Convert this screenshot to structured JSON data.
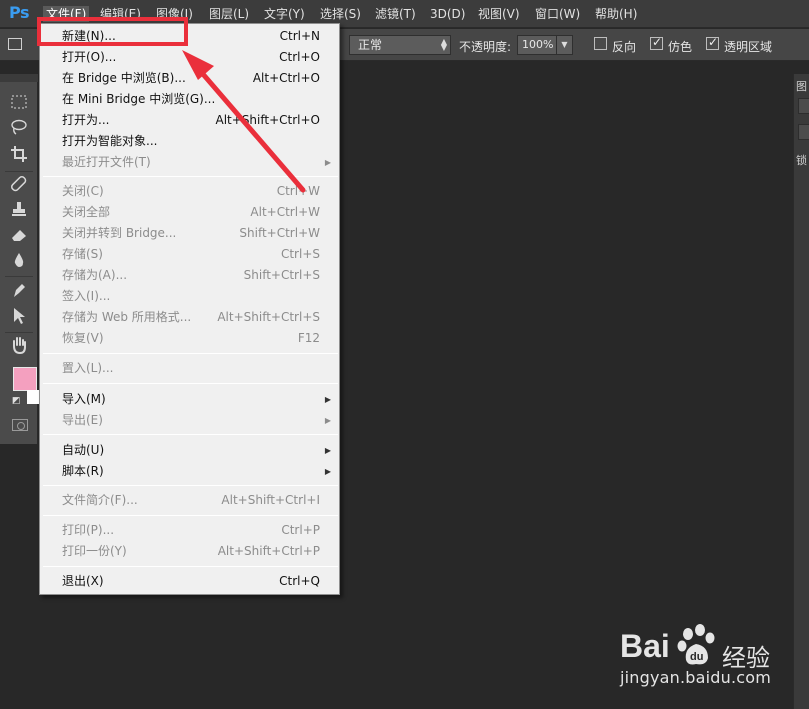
{
  "app": {
    "logo": "Ps",
    "colors": {
      "highlight_annotation": "#ea2f3b",
      "foreground_color": "#f4a0bf",
      "background_color": "#ffffff",
      "workspace_bg": "#282828"
    }
  },
  "menubar": {
    "items": [
      {
        "label": "文件(F)",
        "active": true
      },
      {
        "label": "编辑(E)"
      },
      {
        "label": "图像(I)"
      },
      {
        "label": "图层(L)"
      },
      {
        "label": "文字(Y)"
      },
      {
        "label": "选择(S)"
      },
      {
        "label": "滤镜(T)"
      },
      {
        "label": "3D(D)"
      },
      {
        "label": "视图(V)"
      },
      {
        "label": "窗口(W)"
      },
      {
        "label": "帮助(H)"
      }
    ]
  },
  "options": {
    "mode_value": "正常",
    "opacity_label": "不透明度:",
    "opacity_value": "100%",
    "checkboxes": [
      {
        "label": "反向",
        "checked": false
      },
      {
        "label": "仿色",
        "checked": true
      },
      {
        "label": "透明区域",
        "checked": true
      }
    ]
  },
  "toolbar": {
    "tools": [
      "marquee-icon",
      "lasso-icon",
      "crop-icon",
      "healing-brush-icon",
      "clone-stamp-icon",
      "eraser-icon",
      "blur-drop-icon",
      "pen-icon",
      "path-select-icon",
      "hand-icon"
    ]
  },
  "right_panel": {
    "tab_label": "图",
    "lock_label": "锁"
  },
  "file_menu": {
    "items": [
      {
        "label": "新建(N)...",
        "shortcut": "Ctrl+N"
      },
      {
        "label": "打开(O)...",
        "shortcut": "Ctrl+O"
      },
      {
        "label": "在 Bridge 中浏览(B)...",
        "shortcut": "Alt+Ctrl+O"
      },
      {
        "label": "在 Mini Bridge 中浏览(G)...",
        "shortcut": ""
      },
      {
        "label": "打开为...",
        "shortcut": "Alt+Shift+Ctrl+O"
      },
      {
        "label": "打开为智能对象...",
        "shortcut": ""
      },
      {
        "label": "最近打开文件(T)",
        "shortcut": "",
        "submenu": true,
        "disabled": true
      },
      {
        "label": "关闭(C)",
        "shortcut": "Ctrl+W",
        "disabled": true
      },
      {
        "label": "关闭全部",
        "shortcut": "Alt+Ctrl+W",
        "disabled": true
      },
      {
        "label": "关闭并转到 Bridge...",
        "shortcut": "Shift+Ctrl+W",
        "disabled": true
      },
      {
        "label": "存储(S)",
        "shortcut": "Ctrl+S",
        "disabled": true
      },
      {
        "label": "存储为(A)...",
        "shortcut": "Shift+Ctrl+S",
        "disabled": true
      },
      {
        "label": "签入(I)...",
        "shortcut": "",
        "disabled": true
      },
      {
        "label": "存储为 Web 所用格式...",
        "shortcut": "Alt+Shift+Ctrl+S",
        "disabled": true
      },
      {
        "label": "恢复(V)",
        "shortcut": "F12",
        "disabled": true
      },
      {
        "label": "置入(L)...",
        "shortcut": "",
        "disabled": true
      },
      {
        "label": "导入(M)",
        "shortcut": "",
        "submenu": true
      },
      {
        "label": "导出(E)",
        "shortcut": "",
        "submenu": true,
        "disabled": true
      },
      {
        "label": "自动(U)",
        "shortcut": "",
        "submenu": true
      },
      {
        "label": "脚本(R)",
        "shortcut": "",
        "submenu": true
      },
      {
        "label": "文件简介(F)...",
        "shortcut": "Alt+Shift+Ctrl+I",
        "disabled": true
      },
      {
        "label": "打印(P)...",
        "shortcut": "Ctrl+P",
        "disabled": true
      },
      {
        "label": "打印一份(Y)",
        "shortcut": "Alt+Shift+Ctrl+P",
        "disabled": true
      },
      {
        "label": "退出(X)",
        "shortcut": "Ctrl+Q"
      }
    ]
  },
  "watermark": {
    "brand_prefix": "Bai",
    "brand_suffix": "经验",
    "url": "jingyan.baidu.com"
  }
}
